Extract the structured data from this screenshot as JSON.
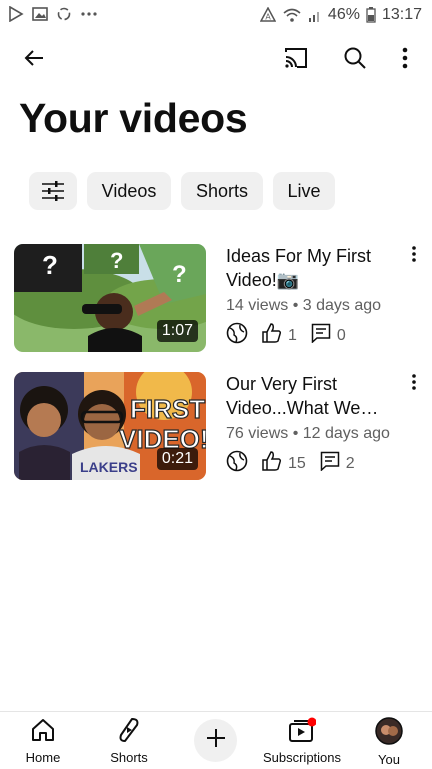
{
  "status_bar": {
    "battery_percent": "46%",
    "time": "13:17"
  },
  "page": {
    "title": "Your videos"
  },
  "chips": [
    {
      "label": "Videos"
    },
    {
      "label": "Shorts"
    },
    {
      "label": "Live"
    }
  ],
  "videos": [
    {
      "title": "Ideas For My First Video!📷",
      "meta": "14 views • 3 days ago",
      "duration": "1:07",
      "likes": "1",
      "comments": "0",
      "thumb_text": ""
    },
    {
      "title": "Our Very First Video...What We Ha...",
      "meta": "76 views • 12 days ago",
      "duration": "0:21",
      "likes": "15",
      "comments": "2",
      "thumb_text": "FIRST VIDEO!!",
      "thumb_text_line1": "FIRST",
      "thumb_text_line2": "VIDEO!!",
      "jersey_text": "LAKERS"
    }
  ],
  "bottom_nav": {
    "home": "Home",
    "shorts": "Shorts",
    "subscriptions": "Subscriptions",
    "you": "You"
  },
  "colors": {
    "accent_red": "#ff0000",
    "text_primary": "#0f0f0f",
    "text_secondary": "#606060",
    "chip_bg": "#f0f0f0"
  },
  "icons": [
    "play-store-icon",
    "gallery-icon",
    "sync-icon",
    "more-dots-icon",
    "alert-icon",
    "wifi-icon",
    "signal-icon",
    "battery-icon",
    "back-arrow-icon",
    "cast-icon",
    "search-icon",
    "overflow-menu-icon",
    "filter-sliders-icon",
    "globe-icon",
    "thumbs-up-icon",
    "comment-icon",
    "home-icon",
    "shorts-icon",
    "plus-icon",
    "subscriptions-icon",
    "avatar"
  ]
}
